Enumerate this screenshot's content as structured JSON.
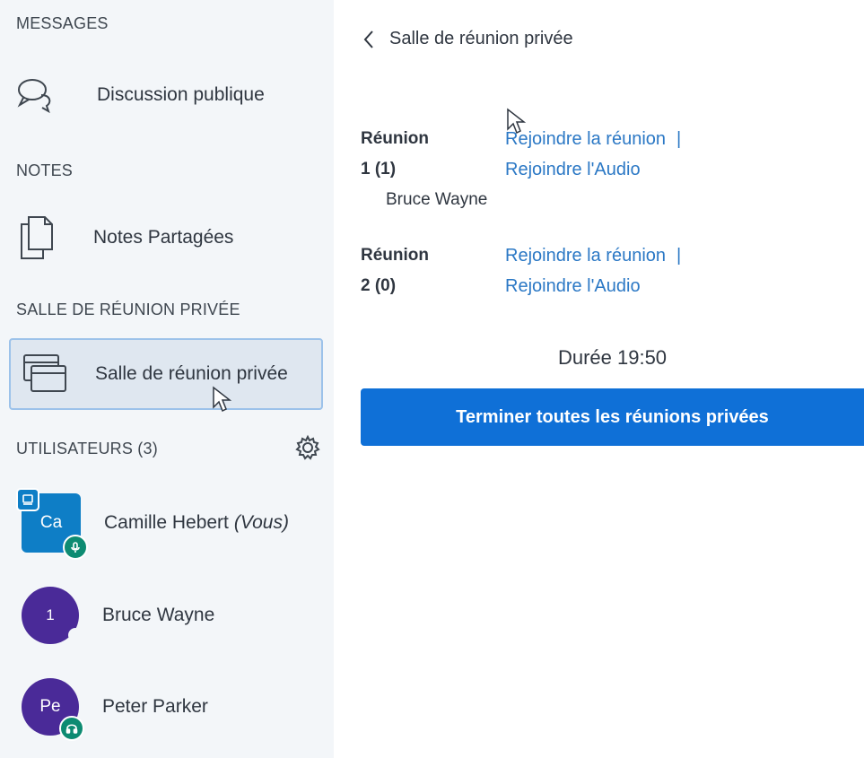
{
  "sidebar": {
    "messages_title": "MESSAGES",
    "public_chat_label": "Discussion publique",
    "notes_title": "NOTES",
    "shared_notes_label": "Notes Partagées",
    "breakout_title": "SALLE DE RÉUNION PRIVÉE",
    "breakout_item_label": "Salle de réunion privée",
    "users_title": "UTILISATEURS (3)",
    "users": [
      {
        "initials": "Ca",
        "name": "Camille Hebert",
        "suffix": "(Vous)"
      },
      {
        "initials": "1",
        "name": "Bruce Wayne",
        "suffix": ""
      },
      {
        "initials": "Pe",
        "name": "Peter Parker",
        "suffix": ""
      }
    ]
  },
  "main": {
    "header_title": "Salle de réunion privée",
    "rooms": [
      {
        "label_line1": "Réunion",
        "label_line2": "1 (1)",
        "join_label": "Rejoindre la réunion",
        "separator": "|",
        "audio_label": "Rejoindre l'Audio",
        "participants": [
          "Bruce Wayne"
        ]
      },
      {
        "label_line1": "Réunion",
        "label_line2": "2 (0)",
        "join_label": "Rejoindre la réunion",
        "separator": "|",
        "audio_label": "Rejoindre l'Audio",
        "participants": []
      }
    ],
    "duration": "Durée 19:50",
    "end_button_label": "Terminer toutes les réunions privées"
  },
  "colors": {
    "accent": "#0f70d7",
    "link": "#2b78c5",
    "sidebar_bg": "#f3f6f9",
    "avatar_blue": "#0e7ec6",
    "avatar_purple": "#4a2a98",
    "badge_green": "#0d8b72"
  },
  "icons": {
    "public_chat": "chat-bubbles-icon",
    "shared_notes": "documents-icon",
    "breakout": "windows-icon",
    "settings": "gear-icon",
    "back": "chevron-left-icon"
  }
}
